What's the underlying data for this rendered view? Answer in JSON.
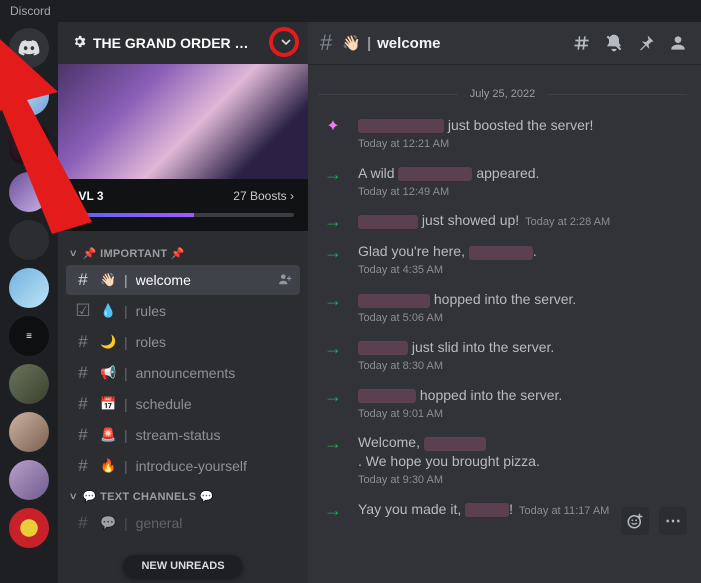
{
  "app_title": "Discord",
  "server": {
    "name": "THE GRAND ORDER …",
    "boost_level": "LVL 3",
    "boost_count": "27 Boosts"
  },
  "categories": [
    {
      "label": "📌 IMPORTANT 📌",
      "channels": [
        {
          "emoji": "👋🏻",
          "name": "welcome",
          "selected": true,
          "addable": true
        },
        {
          "emoji": "💧",
          "name": "rules",
          "icon": "check"
        },
        {
          "emoji": "🌙",
          "name": "roles"
        },
        {
          "emoji": "📢",
          "name": "announcements"
        },
        {
          "emoji": "📅",
          "name": "schedule"
        },
        {
          "emoji": "🚨",
          "name": "stream-status"
        },
        {
          "emoji": "🔥",
          "name": "introduce-yourself"
        }
      ]
    },
    {
      "label": "💬 TEXT CHANNELS 💬",
      "channels": [
        {
          "emoji": "💬",
          "name": "general",
          "muted": true
        }
      ]
    }
  ],
  "new_unreads": "NEW UNREADS",
  "topbar_channel": "welcome",
  "divider_date": "July 25, 2022",
  "messages": [
    {
      "type": "boost",
      "before": "",
      "redact_w": 86,
      "after": " just boosted the server!",
      "ts": "Today at 12:21 AM"
    },
    {
      "type": "join",
      "before": "A wild ",
      "redact_w": 74,
      "after": " appeared.",
      "ts": "Today at 12:49 AM"
    },
    {
      "type": "join",
      "before": "",
      "redact_w": 60,
      "after": " just showed up!",
      "ts": "Today at 2:28 AM",
      "ts_inline": true
    },
    {
      "type": "join",
      "before": "Glad you're here, ",
      "redact_w": 64,
      "after": ".",
      "ts": "Today at 4:35 AM"
    },
    {
      "type": "join",
      "before": "",
      "redact_w": 72,
      "after": " hopped into the server.",
      "ts": "Today at 5:06 AM"
    },
    {
      "type": "join",
      "before": "",
      "redact_w": 50,
      "after": " just slid into the server.",
      "ts": "Today at 8:30 AM"
    },
    {
      "type": "join",
      "before": "",
      "redact_w": 58,
      "after": " hopped into the server.",
      "ts": "Today at 9:01 AM"
    },
    {
      "type": "join",
      "before": "Welcome, ",
      "redact_w": 62,
      "after": ". We hope you brought pizza.",
      "ts": "Today at 9:30 AM",
      "wrap": true
    },
    {
      "type": "join",
      "before": "Yay you made it, ",
      "redact_w": 44,
      "after": "!",
      "ts": "Today at 11:17 AM",
      "ts_inline": true
    }
  ]
}
